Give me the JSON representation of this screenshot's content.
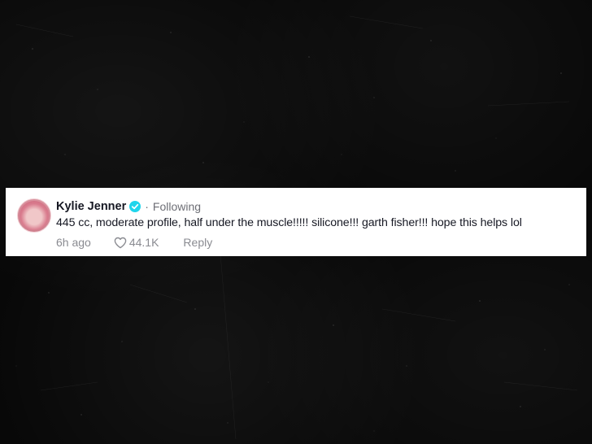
{
  "comment": {
    "username": "Kylie Jenner",
    "verified_icon": "verified-badge-icon",
    "separator": "·",
    "follow_status": "Following",
    "text": "445 cc, moderate profile, half under the muscle!!!!! silicone!!! garth fisher!!! hope this helps lol",
    "time": "6h ago",
    "like_icon": "heart-icon",
    "like_count": "44.1K",
    "reply_label": "Reply"
  },
  "colors": {
    "background": "#080808",
    "card": "#ffffff",
    "text_primary": "#161823",
    "text_secondary": "#8a8b91",
    "verified": "#20d5ec"
  }
}
